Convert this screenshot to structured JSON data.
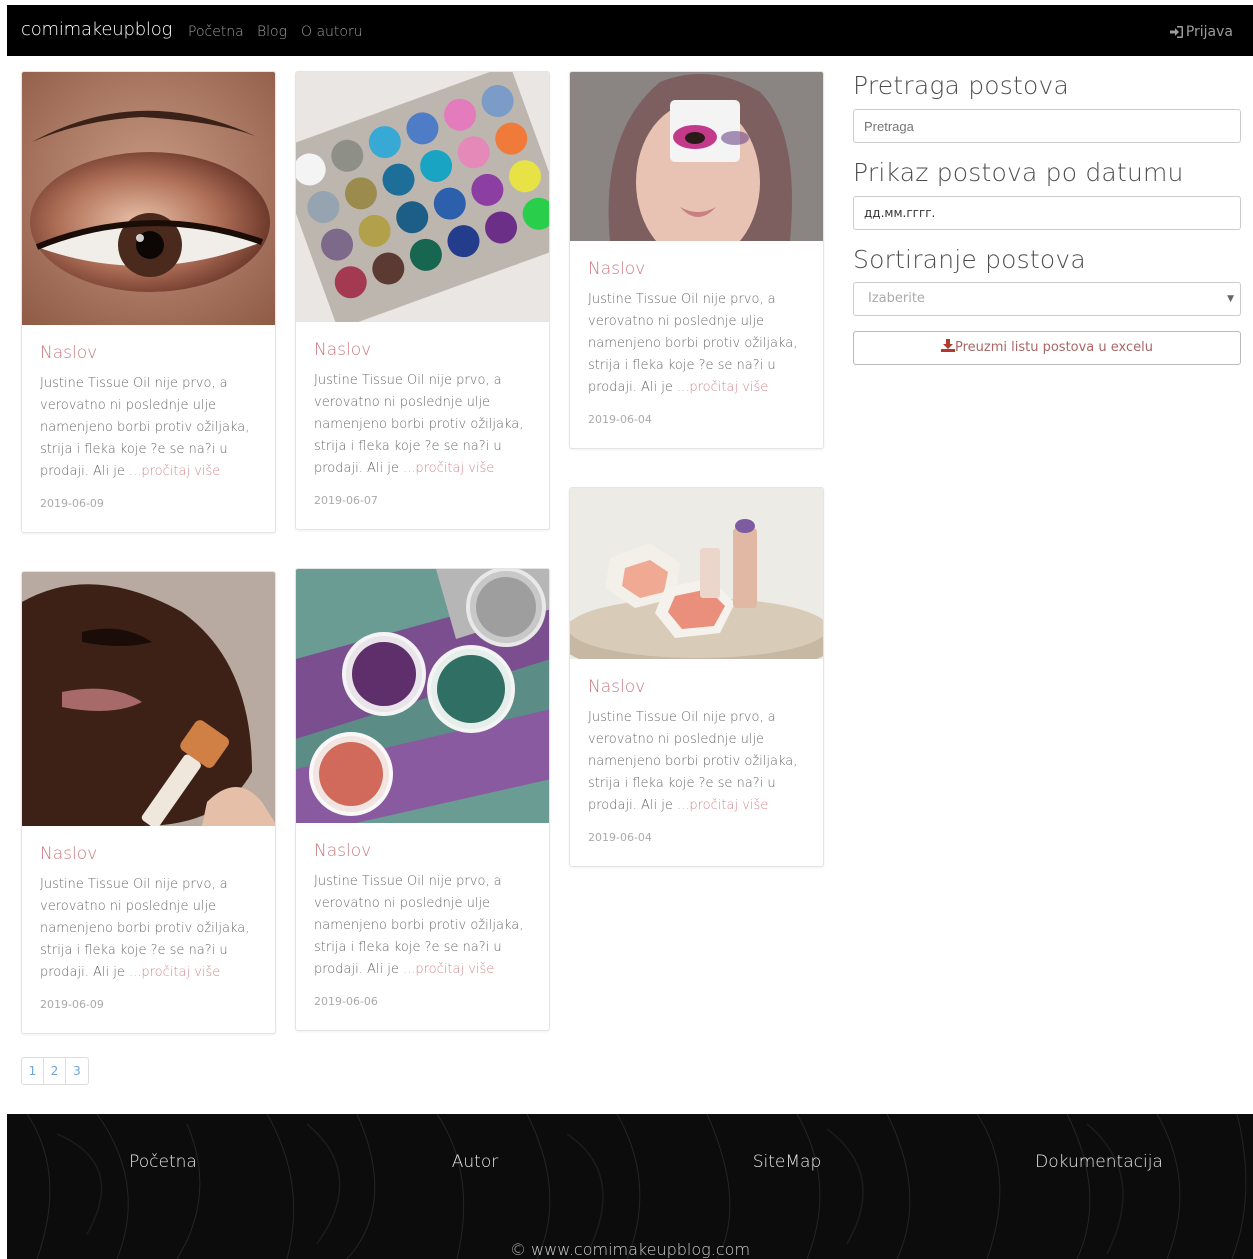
{
  "nav": {
    "brand": "comimakeupblog",
    "links": [
      "Početna",
      "Blog",
      "O autoru"
    ],
    "login": "Prijava"
  },
  "posts": [
    {
      "title": "Naslov",
      "excerpt": "Justine Tissue Oil nije prvo, a verovatno ni poslednje ulje namenjeno borbi protiv ožiljaka, strija i fleka koje ?e se na?i u prodaji. Ali je ",
      "more": "...pročitaj više",
      "date": "2019-06-09"
    },
    {
      "title": "Naslov",
      "excerpt": "Justine Tissue Oil nije prvo, a verovatno ni poslednje ulje namenjeno borbi protiv ožiljaka, strija i fleka koje ?e se na?i u prodaji. Ali je ",
      "more": "...pročitaj više",
      "date": "2019-06-07"
    },
    {
      "title": "Naslov",
      "excerpt": "Justine Tissue Oil nije prvo, a verovatno ni poslednje ulje namenjeno borbi protiv ožiljaka, strija i fleka koje ?e se na?i u prodaji. Ali je ",
      "more": "...pročitaj više",
      "date": "2019-06-04"
    },
    {
      "title": "Naslov",
      "excerpt": "Justine Tissue Oil nije prvo, a verovatno ni poslednje ulje namenjeno borbi protiv ožiljaka, strija i fleka koje ?e se na?i u prodaji. Ali je ",
      "more": "...pročitaj više",
      "date": "2019-06-09"
    },
    {
      "title": "Naslov",
      "excerpt": "Justine Tissue Oil nije prvo, a verovatno ni poslednje ulje namenjeno borbi protiv ožiljaka, strija i fleka koje ?e se na?i u prodaji. Ali je ",
      "more": "...pročitaj više",
      "date": "2019-06-06"
    },
    {
      "title": "Naslov",
      "excerpt": "Justine Tissue Oil nije prvo, a verovatno ni poslednje ulje namenjeno borbi protiv ožiljaka, strija i fleka koje ?e se na?i u prodaji. Ali je ",
      "more": "...pročitaj više",
      "date": "2019-06-04"
    }
  ],
  "sidebar": {
    "search_heading": "Pretraga postova",
    "search_placeholder": "Pretraga",
    "date_heading": "Prikaz postova po datumu",
    "date_value": "дд.мм.гггг.",
    "sort_heading": "Sortiranje postova",
    "sort_selected": "Izaberite",
    "excel_button": "Preuzmi listu postova u excelu"
  },
  "pagination": [
    "1",
    "2",
    "3"
  ],
  "footer": {
    "links": [
      "Početna",
      "Autor",
      "SiteMap",
      "Dokumentacija"
    ],
    "copyright": "© www.comimakeupblog.com"
  },
  "colors": {
    "title_accent": "#c97a80",
    "link_blue": "#6fa4d6",
    "navbar_bg": "#000000",
    "excel_icon": "#b03a2e"
  }
}
